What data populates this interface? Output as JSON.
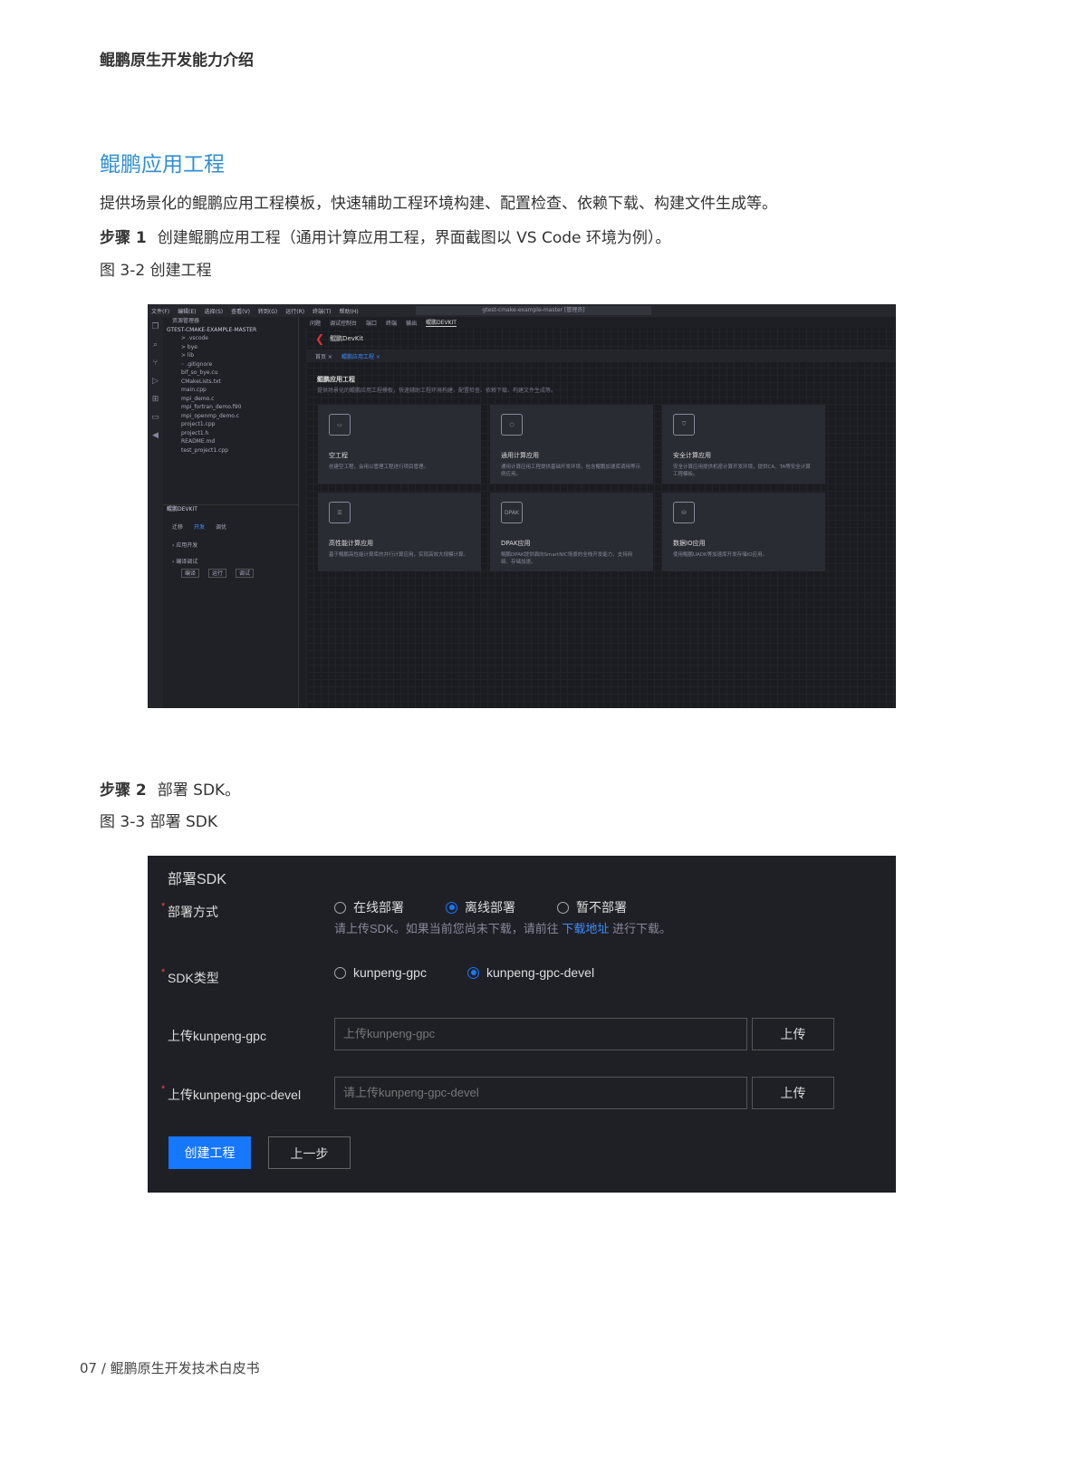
{
  "header": "鲲鹏原生开发能力介绍",
  "section_title": "鲲鹏应用工程",
  "intro": "提供场景化的鲲鹏应用工程模板，快速辅助工程环境构建、配置检查、依赖下载、构建文件生成等。",
  "step1": {
    "label": "步骤 1",
    "text": "创建鲲鹏应用工程（通用计算应用工程，界面截图以 VS Code 环境为例）。"
  },
  "fig1_caption": "图 3-2 创建工程",
  "vscode": {
    "menu": [
      "文件(F)",
      "编辑(E)",
      "选择(S)",
      "查看(V)",
      "转到(G)",
      "运行(R)",
      "终端(T)",
      "帮助(H)"
    ],
    "search": "gtest-cmake-example-master [管理员]",
    "explorer_title": "资源管理器",
    "project": "GTEST-CMAKE-EXAMPLE-MASTER",
    "files": [
      "> .vscode",
      "> bye",
      "> lib",
      "◦ .gitignore",
      "bif_so_bye.cu",
      "CMakeLists.txt",
      "main.cpp",
      "mpi_demo.c",
      "mpi_fortran_demo.f90",
      "mpi_openmp_demo.c",
      "project1.cpp",
      "project1.h",
      "README.md",
      "test_project1.cpp"
    ],
    "devkit_panel": "鲲鹏DEVKIT",
    "devkit_tabs": [
      "迁移",
      "开发",
      "调优"
    ],
    "devkit_items": [
      "› 应用开发",
      "› 编译调试"
    ],
    "devkit_buttons": [
      "编译",
      "运行",
      "调试"
    ],
    "panel_tabs": [
      "问题",
      "调试控制台",
      "端口",
      "终端",
      "输出",
      "鲲鹏DEVKIT"
    ],
    "brand": "鲲鹏DevKit",
    "editor_tabs": [
      "首页 ×",
      "鲲鹏应用工程 ×"
    ],
    "page_title": "鲲鹏应用工程",
    "page_desc": "提供场景化的鲲鹏应用工程模板，快速辅助工程环境构建、配置检查、依赖下载、构建文件生成等。",
    "cards": [
      {
        "icon": "window-icon",
        "title": "空工程",
        "desc": "创建空工程，会用以管理工程进行项目管理。"
      },
      {
        "icon": "cube-icon",
        "title": "通用计算应用",
        "desc": "通用计算应用工程提供基础开发环境，包含鲲鹏加速库调用等示例应用。"
      },
      {
        "icon": "shield-icon",
        "title": "安全计算应用",
        "desc": "安全计算应用提供机密计算开发环境，提供CA、TA等安全计算工程模板。"
      },
      {
        "icon": "server-icon",
        "title": "高性能计算应用",
        "desc": "基于鲲鹏高性能计算库的并行计算应用，实现高效大规模计算。"
      },
      {
        "icon": "dpak-icon",
        "glyph": "DPAK",
        "title": "DPAK应用",
        "desc": "鲲鹏DPAK提供面向SmartNIC场景的全栈开发能力，支持网络、存储加速。"
      },
      {
        "icon": "database-icon",
        "title": "数据IO应用",
        "desc": "使用鲲鹏UADK等加速库开发存储IO应用。"
      }
    ]
  },
  "step2": {
    "label": "步骤 2",
    "text": "部署 SDK。"
  },
  "fig2_caption": "图 3-3 部署 SDK",
  "sdk": {
    "title": "部署SDK",
    "deploy_label": "部署方式",
    "deploy_options": [
      "在线部署",
      "离线部署",
      "暂不部署"
    ],
    "deploy_selected": 1,
    "hint_pre": "请上传SDK。如果当前您尚未下载，请前往",
    "hint_link": "下载地址",
    "hint_post": "进行下载。",
    "type_label": "SDK类型",
    "type_options": [
      "kunpeng-gpc",
      "kunpeng-gpc-devel"
    ],
    "type_selected": 1,
    "upload1_label": "上传kunpeng-gpc",
    "upload1_placeholder": "上传kunpeng-gpc",
    "upload2_label": "上传kunpeng-gpc-devel",
    "upload2_placeholder": "请上传kunpeng-gpc-devel",
    "upload_button": "上传",
    "create_button": "创建工程",
    "prev_button": "上一步",
    "accent": "#1677ff"
  },
  "footer": "07 / 鲲鹏原生开发技术白皮书"
}
